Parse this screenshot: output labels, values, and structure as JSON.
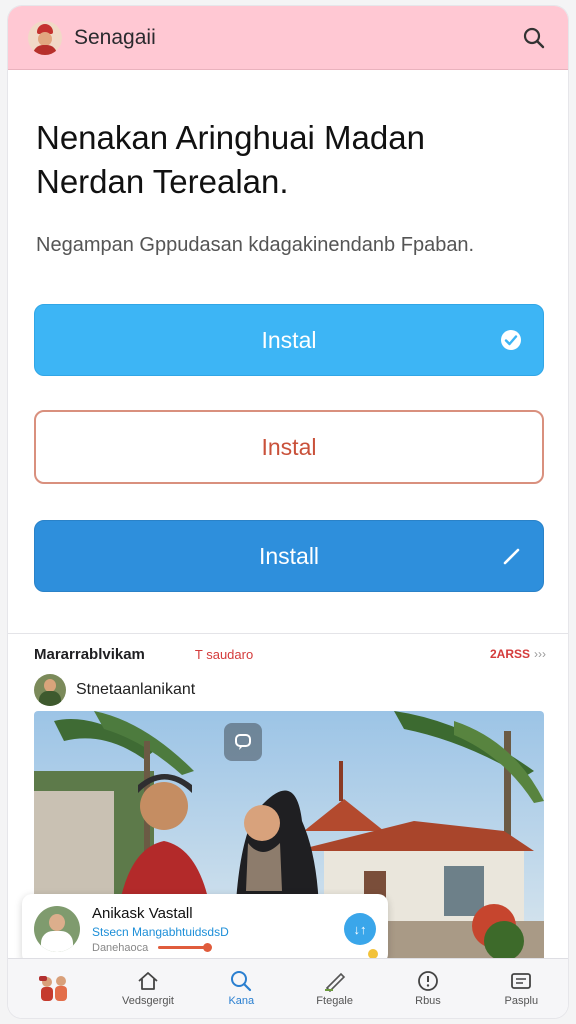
{
  "header": {
    "app_title": "Senagaii"
  },
  "hero": {
    "title": "Nenakan Aringhuai Madan Nerdan Terealan.",
    "subtitle": "Negampan Gppudasan kdagakinendanb Fpaban."
  },
  "buttons": [
    {
      "label": "Instal",
      "style": "filled-light",
      "trail_icon": "check-circle-icon"
    },
    {
      "label": "Instal",
      "style": "outlined"
    },
    {
      "label": "Install",
      "style": "filled-dark",
      "trail_icon": "pencil-icon"
    }
  ],
  "feed": {
    "section_title": "Mararrablvikam",
    "tag": "T saudaro",
    "count": "2ARSS",
    "more": "›››",
    "post": {
      "author": "Stnetaanlanikant"
    }
  },
  "notification": {
    "title": "Anikask Vastall",
    "subtitle": "Stsecn MangabhtuidsdsD",
    "meta": "Danehaoca",
    "action": "↓↑"
  },
  "nav": [
    {
      "label": "",
      "icon": "people-illustration-icon"
    },
    {
      "label": "Vedsgergit",
      "icon": "home-icon"
    },
    {
      "label": "Kana",
      "icon": "search-icon"
    },
    {
      "label": "Ftegale",
      "icon": "pencil-chart-icon"
    },
    {
      "label": "Rbus",
      "icon": "info-circle-icon"
    },
    {
      "label": "Pasplu",
      "icon": "inbox-icon"
    }
  ],
  "colors": {
    "header_bg": "#ffc8d3",
    "button_light": "#3db5f5",
    "button_outline": "#d9907e",
    "button_dark": "#2e8fdc",
    "accent_red": "#d43b3b",
    "nav_active": "#2a7fd0"
  }
}
